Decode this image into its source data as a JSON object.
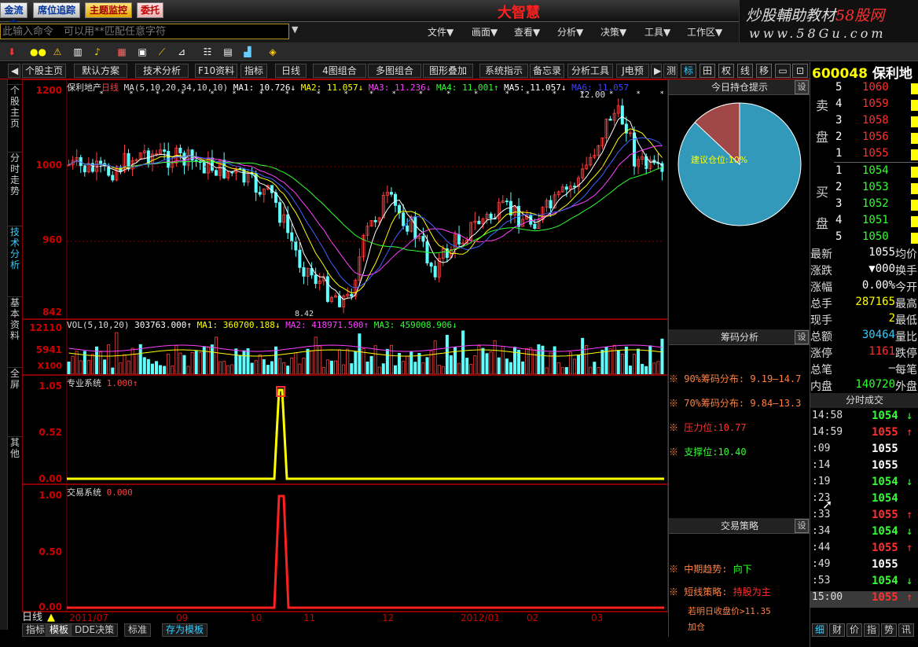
{
  "app": {
    "title": "大智慧",
    "brand_line1": "炒股輔助教材",
    "brand_line1_accent": "58股网",
    "brand_line2": "www.58Gu.com"
  },
  "top_buttons": [
    "金流向",
    "席位追踪",
    "主题监控",
    "委托"
  ],
  "command": {
    "placeholder": "此输入命令　可以用**匹配任意字符"
  },
  "menus": [
    "文件▼",
    "画面▼",
    "查看▼",
    "分析▼",
    "决策▼",
    "工具▼",
    "工作区▼"
  ],
  "tabs": [
    "◀",
    "个股主页",
    "默认方案",
    "技术分析",
    "F10资料",
    "指标",
    "日线",
    "4图组合",
    "多图组合",
    "图形叠加",
    "系统指示",
    "备忘录",
    "分析工具",
    "J电预",
    "▶",
    "测"
  ],
  "right_tab_icons": [
    "标",
    "田",
    "权",
    "线",
    "移",
    "▭",
    "⊡"
  ],
  "vtabs": [
    "个股主页",
    "分时走势",
    "技术分析",
    "基本资料",
    "全屏",
    "其他"
  ],
  "stock": {
    "code": "600048",
    "name": "保利地"
  },
  "main_chart": {
    "header_name": "保利地产",
    "header_period": "日线",
    "ma_text": "MA(5,10,20,34,10,10)",
    "ma": [
      {
        "label": "MA1: 10.726↓",
        "color": "#ffffff"
      },
      {
        "label": "MA2: 11.057↓",
        "color": "#ffff00"
      },
      {
        "label": "MA3: 11.236↓",
        "color": "#ff40ff"
      },
      {
        "label": "MA4: 11.001↑",
        "color": "#30ff30"
      },
      {
        "label": "MA5: 11.057↓",
        "color": "#ffffff"
      },
      {
        "label": "MA6: 11.057",
        "color": "#4040ff"
      }
    ],
    "y_labels": [
      "1200",
      "1000",
      "960",
      "842"
    ],
    "high_label": "12.00",
    "low_label": "8.42"
  },
  "volume": {
    "header": "VOL(5,10,20)",
    "vol": "303763.000↑",
    "ma1": "MA1: 360700.188↓",
    "ma2": "MA2: 418971.500↑",
    "ma3": "MA3: 459008.906↓",
    "y_labels": [
      "12110",
      "5941",
      "X100"
    ]
  },
  "pro_system": {
    "header": "专业系统",
    "value": "1.000↑",
    "y_labels": [
      "1.05",
      "0.52",
      "0.00"
    ]
  },
  "trade_system": {
    "header": "交易系统",
    "value": "0.000",
    "y_labels": [
      "1.00",
      "0.50",
      "0.00"
    ]
  },
  "x_axis": {
    "period_label": "日线",
    "dates": [
      "2011/07",
      "09",
      "10",
      "11",
      "12",
      "2012/01",
      "02",
      "03"
    ]
  },
  "bottom_tabs": [
    "指标",
    "模板",
    "DDE决策",
    "标准",
    "存为模板"
  ],
  "holdings": {
    "title": "今日持仓提示",
    "set": "设",
    "pie_label": "建议仓位:10%",
    "position_pct": 10
  },
  "chips": {
    "title": "筹码分析",
    "set": "设",
    "items": [
      {
        "text": "90%筹码分布: 9.19—14.7",
        "color": "#ff8040"
      },
      {
        "text": "70%筹码分布: 9.84—13.3",
        "color": "#ff8040"
      },
      {
        "text": "压力位:10.77",
        "color": "#ff3030"
      },
      {
        "text": "支撑位:10.40",
        "color": "#30ff30"
      }
    ]
  },
  "strategy": {
    "title": "交易策略",
    "set": "设",
    "mid_label": "中期趋势:",
    "mid_value": "向下",
    "short_label": "短线策略:",
    "short_value": "持股为主",
    "note1": "若明日收盘价>11.35",
    "note2": "加仓"
  },
  "quote": {
    "sell_label": "卖盘",
    "buy_label": "买盘",
    "sell": [
      {
        "n": "5",
        "p": "1060"
      },
      {
        "n": "4",
        "p": "1059"
      },
      {
        "n": "3",
        "p": "1058"
      },
      {
        "n": "2",
        "p": "1056"
      },
      {
        "n": "1",
        "p": "1055"
      }
    ],
    "buy": [
      {
        "n": "1",
        "p": "1054"
      },
      {
        "n": "2",
        "p": "1053"
      },
      {
        "n": "3",
        "p": "1052"
      },
      {
        "n": "4",
        "p": "1051"
      },
      {
        "n": "5",
        "p": "1050"
      }
    ],
    "stats": [
      {
        "k": "最新",
        "v": "1055",
        "c": "#ffffff",
        "k2": "均价"
      },
      {
        "k": "涨跌",
        "v": "▼000",
        "c": "#ffffff",
        "k2": "换手"
      },
      {
        "k": "涨幅",
        "v": "0.00%",
        "c": "#ffffff",
        "k2": "今开"
      },
      {
        "k": "总手",
        "v": "287165",
        "c": "#ffff00",
        "k2": "最高"
      },
      {
        "k": "现手",
        "v": "2",
        "c": "#ffff00",
        "k2": "最低"
      },
      {
        "k": "总额",
        "v": "30464",
        "c": "#33ccff",
        "k2": "量比"
      },
      {
        "k": "涨停",
        "v": "1161",
        "c": "#ff3030",
        "k2": "跌停"
      },
      {
        "k": "总笔",
        "v": "—",
        "c": "#ffffff",
        "k2": "每笔"
      },
      {
        "k": "内盘",
        "v": "140720",
        "c": "#30ff30",
        "k2": "外盘"
      }
    ],
    "ticks_title": "分时成交",
    "ticks": [
      {
        "t": "14:58",
        "p": "1054",
        "a": "↓",
        "c": "#30ff30"
      },
      {
        "t": "14:59",
        "p": "1055",
        "a": "↑",
        "c": "#ff3030"
      },
      {
        "t": ":09",
        "p": "1055",
        "a": "",
        "c": "#ffffff"
      },
      {
        "t": ":14",
        "p": "1055",
        "a": "",
        "c": "#ffffff"
      },
      {
        "t": ":19",
        "p": "1054",
        "a": "↓",
        "c": "#30ff30"
      },
      {
        "t": ":23",
        "p": "1054",
        "a": "",
        "c": "#30ff30"
      },
      {
        "t": ":33",
        "p": "1055",
        "a": "↑",
        "c": "#ff3030"
      },
      {
        "t": ":34",
        "p": "1054",
        "a": "↓",
        "c": "#30ff30"
      },
      {
        "t": ":44",
        "p": "1055",
        "a": "↑",
        "c": "#ff3030"
      },
      {
        "t": ":49",
        "p": "1055",
        "a": "",
        "c": "#ffffff"
      },
      {
        "t": ":53",
        "p": "1054",
        "a": "↓",
        "c": "#30ff30"
      },
      {
        "t": "15:00",
        "p": "1055",
        "a": "↑",
        "c": "#ff3030"
      }
    ],
    "bottom_tabs": [
      "细",
      "财",
      "价",
      "指",
      "势",
      "讯"
    ]
  }
}
